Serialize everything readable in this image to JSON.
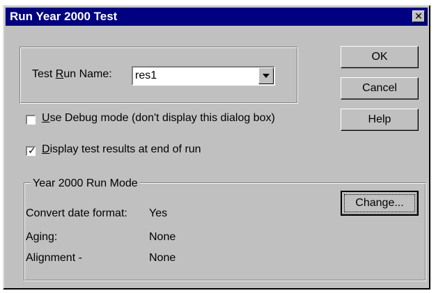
{
  "window": {
    "title": "Run Year 2000 Test",
    "close_label": "✕"
  },
  "test_run": {
    "label_prefix": "Test ",
    "label_accel": "R",
    "label_suffix": "un Name:",
    "combo_value": "res1"
  },
  "buttons": {
    "ok": "OK",
    "cancel": "Cancel",
    "help": "Help",
    "change": "Change..."
  },
  "options": {
    "debug_accel": "U",
    "debug_rest": "se Debug mode (don't display this dialog box)",
    "debug_checked": false,
    "display_accel": "D",
    "display_rest": "isplay test results at end of run",
    "display_checked": true
  },
  "run_mode": {
    "legend": "Year 2000 Run Mode",
    "rows": [
      {
        "label": "Convert date format:",
        "value": "Yes"
      },
      {
        "label": "Aging:",
        "value": "None"
      },
      {
        "label": "Alignment -",
        "value": "None"
      }
    ]
  },
  "colors": {
    "titlebar": "#000080",
    "face": "#c0c0c0"
  },
  "icons": {
    "close": "close-icon",
    "dropdown": "chevron-down-icon",
    "check": "checkmark-icon"
  }
}
